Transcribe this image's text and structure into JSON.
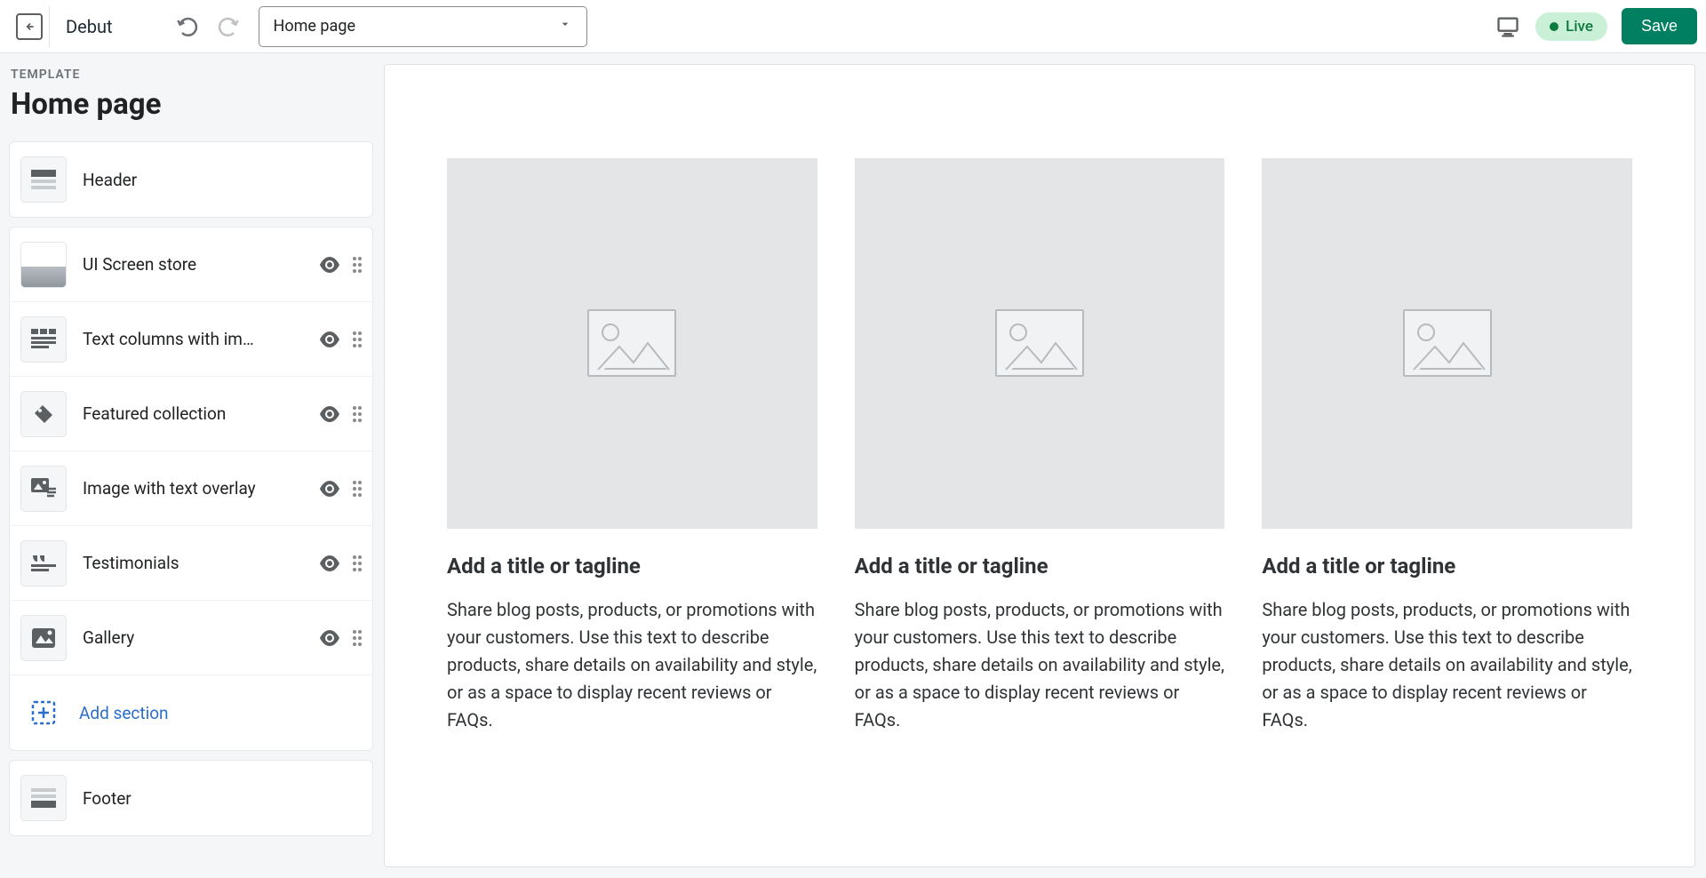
{
  "topbar": {
    "theme_name": "Debut",
    "page_select_value": "Home page",
    "live_label": "Live",
    "save_label": "Save"
  },
  "sidebar": {
    "template_label": "TEMPLATE",
    "page_title": "Home page",
    "header_label": "Header",
    "sections": [
      {
        "label": "UI Screen store",
        "icon": "thumb"
      },
      {
        "label": "Text columns with im…",
        "icon": "text-columns"
      },
      {
        "label": "Featured collection",
        "icon": "tag"
      },
      {
        "label": "Image with text overlay",
        "icon": "image-overlay"
      },
      {
        "label": "Testimonials",
        "icon": "quote"
      },
      {
        "label": "Gallery",
        "icon": "gallery"
      }
    ],
    "add_section_label": "Add section",
    "footer_label": "Footer"
  },
  "preview": {
    "columns": [
      {
        "title": "Add a title or tagline",
        "text": "Share blog posts, products, or promotions with your customers. Use this text to describe products, share details on availability and style, or as a space to display recent reviews or FAQs."
      },
      {
        "title": "Add a title or tagline",
        "text": "Share blog posts, products, or promotions with your customers. Use this text to describe products, share details on availability and style, or as a space to display recent reviews or FAQs."
      },
      {
        "title": "Add a title or tagline",
        "text": "Share blog posts, products, or promotions with your customers. Use this text to describe products, share details on availability and style, or as a space to display recent reviews or FAQs."
      }
    ]
  }
}
